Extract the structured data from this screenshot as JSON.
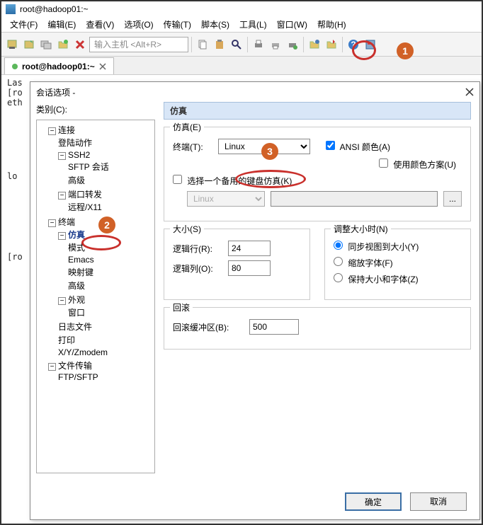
{
  "window": {
    "title": "root@hadoop01:~"
  },
  "menus": [
    "文件(F)",
    "编辑(E)",
    "查看(V)",
    "选项(O)",
    "传输(T)",
    "脚本(S)",
    "工具(L)",
    "窗口(W)",
    "帮助(H)"
  ],
  "toolbar": {
    "host_placeholder": "输入主机 <Alt+R>"
  },
  "tab": {
    "label": "root@hadoop01:~"
  },
  "terminal": {
    "l1": "Las",
    "l2": "[ro",
    "l3": "eth",
    "l4": "lo",
    "l5": "[ro"
  },
  "dialog": {
    "title": "会话选项 - ",
    "category_label": "类别(C):",
    "ok": "确定",
    "cancel": "取消"
  },
  "tree": {
    "n0": "连接",
    "n1": "登陆动作",
    "n2": "SSH2",
    "n3": "SFTP 会话",
    "n4": "高级",
    "n5": "端口转发",
    "n6": "远程/X11",
    "n7": "终端",
    "n8": "仿真",
    "n9": "模式",
    "n10": "Emacs",
    "n11": "映射键",
    "n12": "高级",
    "n13": "外观",
    "n14": "窗口",
    "n15": "日志文件",
    "n16": "打印",
    "n17": "X/Y/Zmodem",
    "n18": "文件传输",
    "n19": "FTP/SFTP"
  },
  "panel": {
    "header": "仿真",
    "emu_legend": "仿真(E)",
    "terminal_label": "终端(T):",
    "terminal_value": "Linux",
    "ansi_color": " ANSI 颜色(A)",
    "use_scheme": " 使用颜色方案(U)",
    "alt_kb": " 选择一个备用的键盘仿真(K)",
    "alt_kb_value": "Linux",
    "size_legend": "大小(S)",
    "rows_label": "逻辑行(R):",
    "rows_value": "24",
    "cols_label": "逻辑列(O):",
    "cols_value": "80",
    "resize_legend": "调整大小时(N)",
    "r1": " 同步视图到大小(Y)",
    "r2": " 缩放字体(F)",
    "r3": " 保持大小和字体(Z)",
    "scroll_legend": "回滚",
    "scrollback_label": "回滚缓冲区(B):",
    "scrollback_value": "500",
    "ellipsis": "..."
  },
  "badges": {
    "b1": "1",
    "b2": "2",
    "b3": "3"
  }
}
